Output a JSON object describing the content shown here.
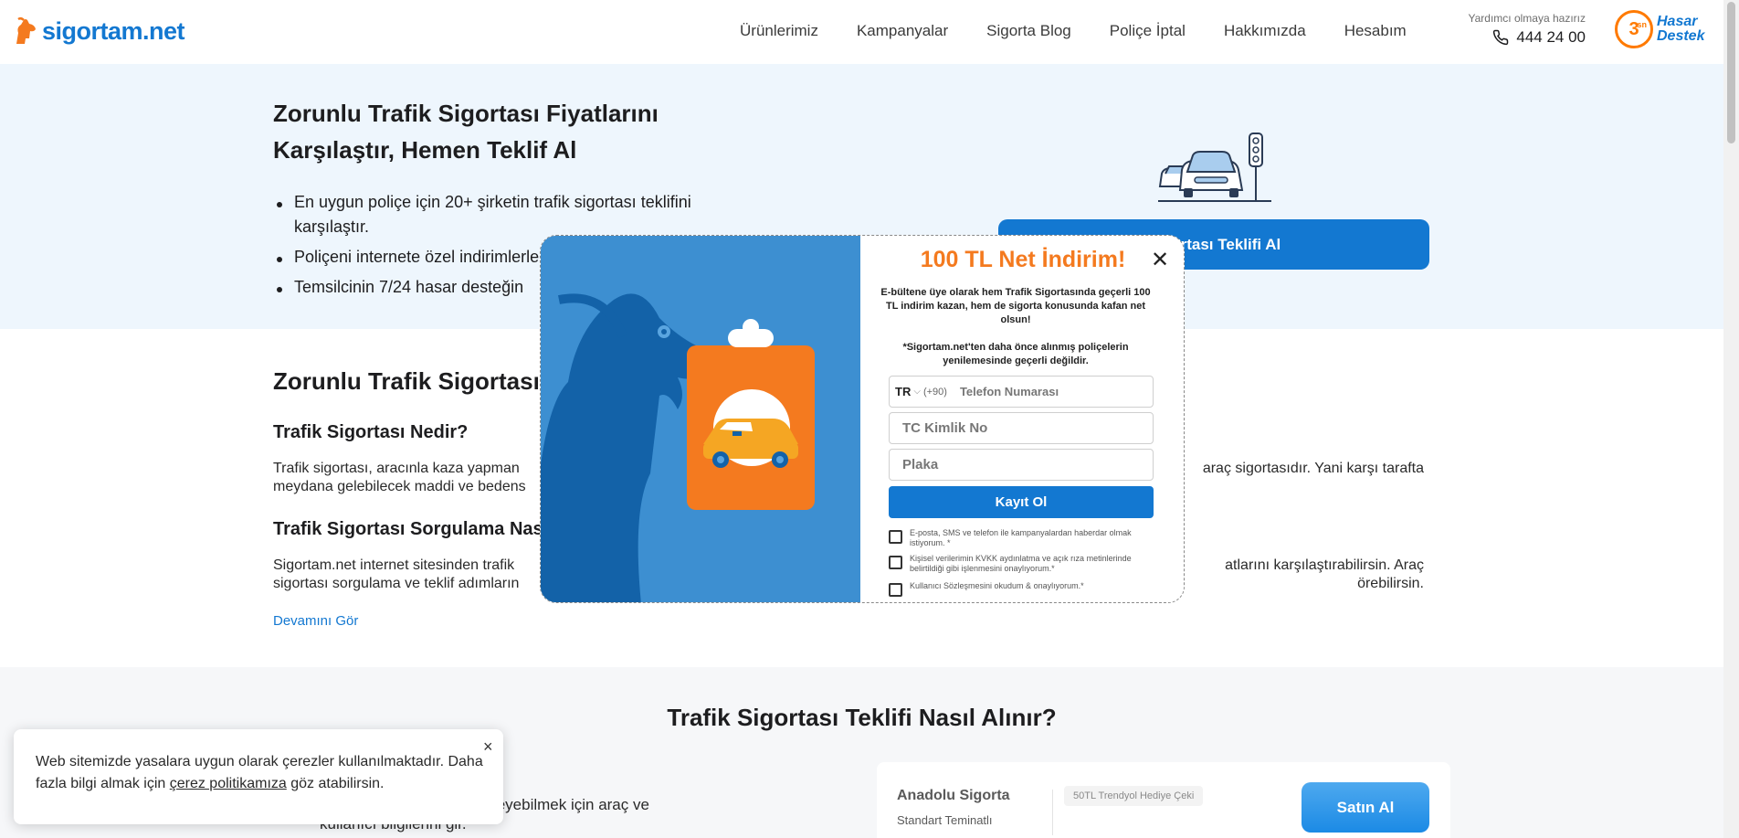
{
  "header": {
    "logo_text": "sigortam.net",
    "nav": [
      "Ürünlerimiz",
      "Kampanyalar",
      "Sigorta Blog",
      "Poliçe İptal",
      "Hakkımızda",
      "Hesabım"
    ],
    "help_text": "Yardımcı olmaya hazırız",
    "phone": "444 24 00",
    "hasar_badge": "3",
    "hasar_badge_sub": "sn",
    "hasar_line1": "Hasar",
    "hasar_line2": "Destek"
  },
  "hero": {
    "title": "Zorunlu Trafik Sigortası Fiyatlarını Karşılaştır, Hemen Teklif Al",
    "bullets": [
      "En uygun poliçe için 20+ şirketin trafik sigortası teklifini karşılaştır.",
      "Poliçeni internete özel indirimlerle",
      "Temsilcinin 7/24 hasar desteğin"
    ],
    "cta": "Sigortası Teklifi Al"
  },
  "info": {
    "h2": "Zorunlu Trafik Sigortası",
    "h3a": "Trafik Sigortası Nedir?",
    "p1_left": "Trafik sigortası, aracınla kaza yapman",
    "p1_right": "araç sigortasıdır. Yani karşı tarafta",
    "p1_line2": "meydana gelebilecek maddi ve bedens",
    "h3b": "Trafik Sigortası Sorgulama Nas",
    "p2_left": "Sigortam.net internet sitesinden trafik",
    "p2_right": "atlarını karşılaştırabilirsin. Araç",
    "p2_line2_left": "sigortası sorgulama ve teklif adımların",
    "p2_line2_right": "örebilirsin.",
    "more_link": "Devamını Gör"
  },
  "steps": {
    "title": "Trafik Sigortası Teklifi Nasıl Alınır?",
    "text_line1": "gortası tekliflerini görüntüleyebilmek için araç ve",
    "text_line2": "kullanıcı bilgilerini gir.",
    "offer": {
      "company": "Anadolu Sigorta",
      "plan": "Standart Teminatlı",
      "gift": "50TL Trendyol Hediye Çeki",
      "buy": "Satın Al"
    }
  },
  "cookie": {
    "text_before": "Web sitemizde yasalara uygun olarak çerezler kullanılmaktadır. Daha fazla bilgi almak için ",
    "link": "çerez politikamıza",
    "text_after": " göz atabilirsin.",
    "close": "×"
  },
  "modal": {
    "title": "100 TL Net İndirim!",
    "close": "✕",
    "desc": "E-bültene üye olarak hem Trafik Sigortasında geçerli 100 TL indirim kazan, hem de sigorta konusunda kafan net olsun!",
    "note": "*Sigortam.net'ten daha önce alınmış poliçelerin yenilemesinde geçerli değildir.",
    "country_code": "TR",
    "dial_code": "(+90)",
    "phone_placeholder": "Telefon Numarası",
    "tc_placeholder": "TC Kimlik No",
    "plate_placeholder": "Plaka",
    "submit": "Kayıt Ol",
    "consents": [
      "E-posta, SMS ve telefon ile kampanyalardan haberdar olmak istiyorum. *",
      "Kişisel verilerimin KVKK aydınlatma ve açık rıza metinlerinde belirtildiği gibi işlenmesini onaylıyorum.*",
      "Kullanıcı Sözleşmesini okudum & onaylıyorum.*"
    ]
  },
  "colors": {
    "brand_blue": "#1378d1",
    "brand_orange": "#f47a1f",
    "hero_bg": "#eef6fd",
    "modal_left_bg": "#3d8fd1"
  },
  "icons": [
    "goat-logo-icon",
    "phone-icon",
    "cars-traffic-light-icon",
    "close-icon",
    "chevron-down-icon",
    "goat-clipboard-illustration"
  ]
}
